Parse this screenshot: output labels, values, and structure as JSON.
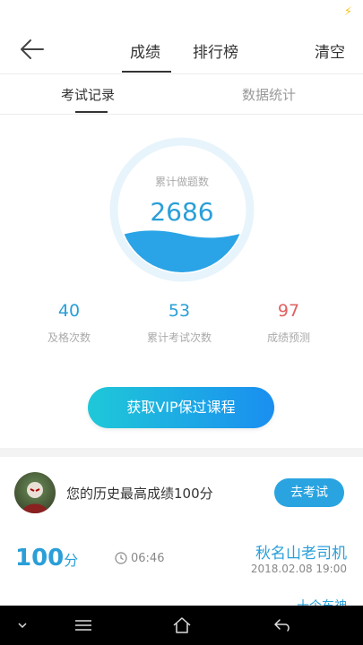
{
  "status": {
    "icon": "lightning-icon"
  },
  "header": {
    "tabs": [
      "成绩",
      "排行榜"
    ],
    "active_tab": 0,
    "clear_label": "清空"
  },
  "subtabs": [
    "考试记录",
    "数据统计"
  ],
  "summary": {
    "circle_label": "累计做题数",
    "total_questions": "2686",
    "stats": [
      {
        "value": "40",
        "label": "及格次数",
        "color": "#2a9fd8"
      },
      {
        "value": "53",
        "label": "累计考试次数",
        "color": "#2a9fd8"
      },
      {
        "value": "97",
        "label": "成绩预测",
        "color": "#e06060"
      }
    ],
    "vip_button": "获取VIP保过课程"
  },
  "best": {
    "text": "您的历史最高成绩100分",
    "button": "去考试"
  },
  "record": {
    "score": "100",
    "unit": "分",
    "duration": "06:46",
    "title": "秋名山老司机",
    "date": "2018.02.08  19:00",
    "partial_text": "十个车神"
  },
  "colors": {
    "accent": "#2a9fd8",
    "warn": "#e06060"
  }
}
